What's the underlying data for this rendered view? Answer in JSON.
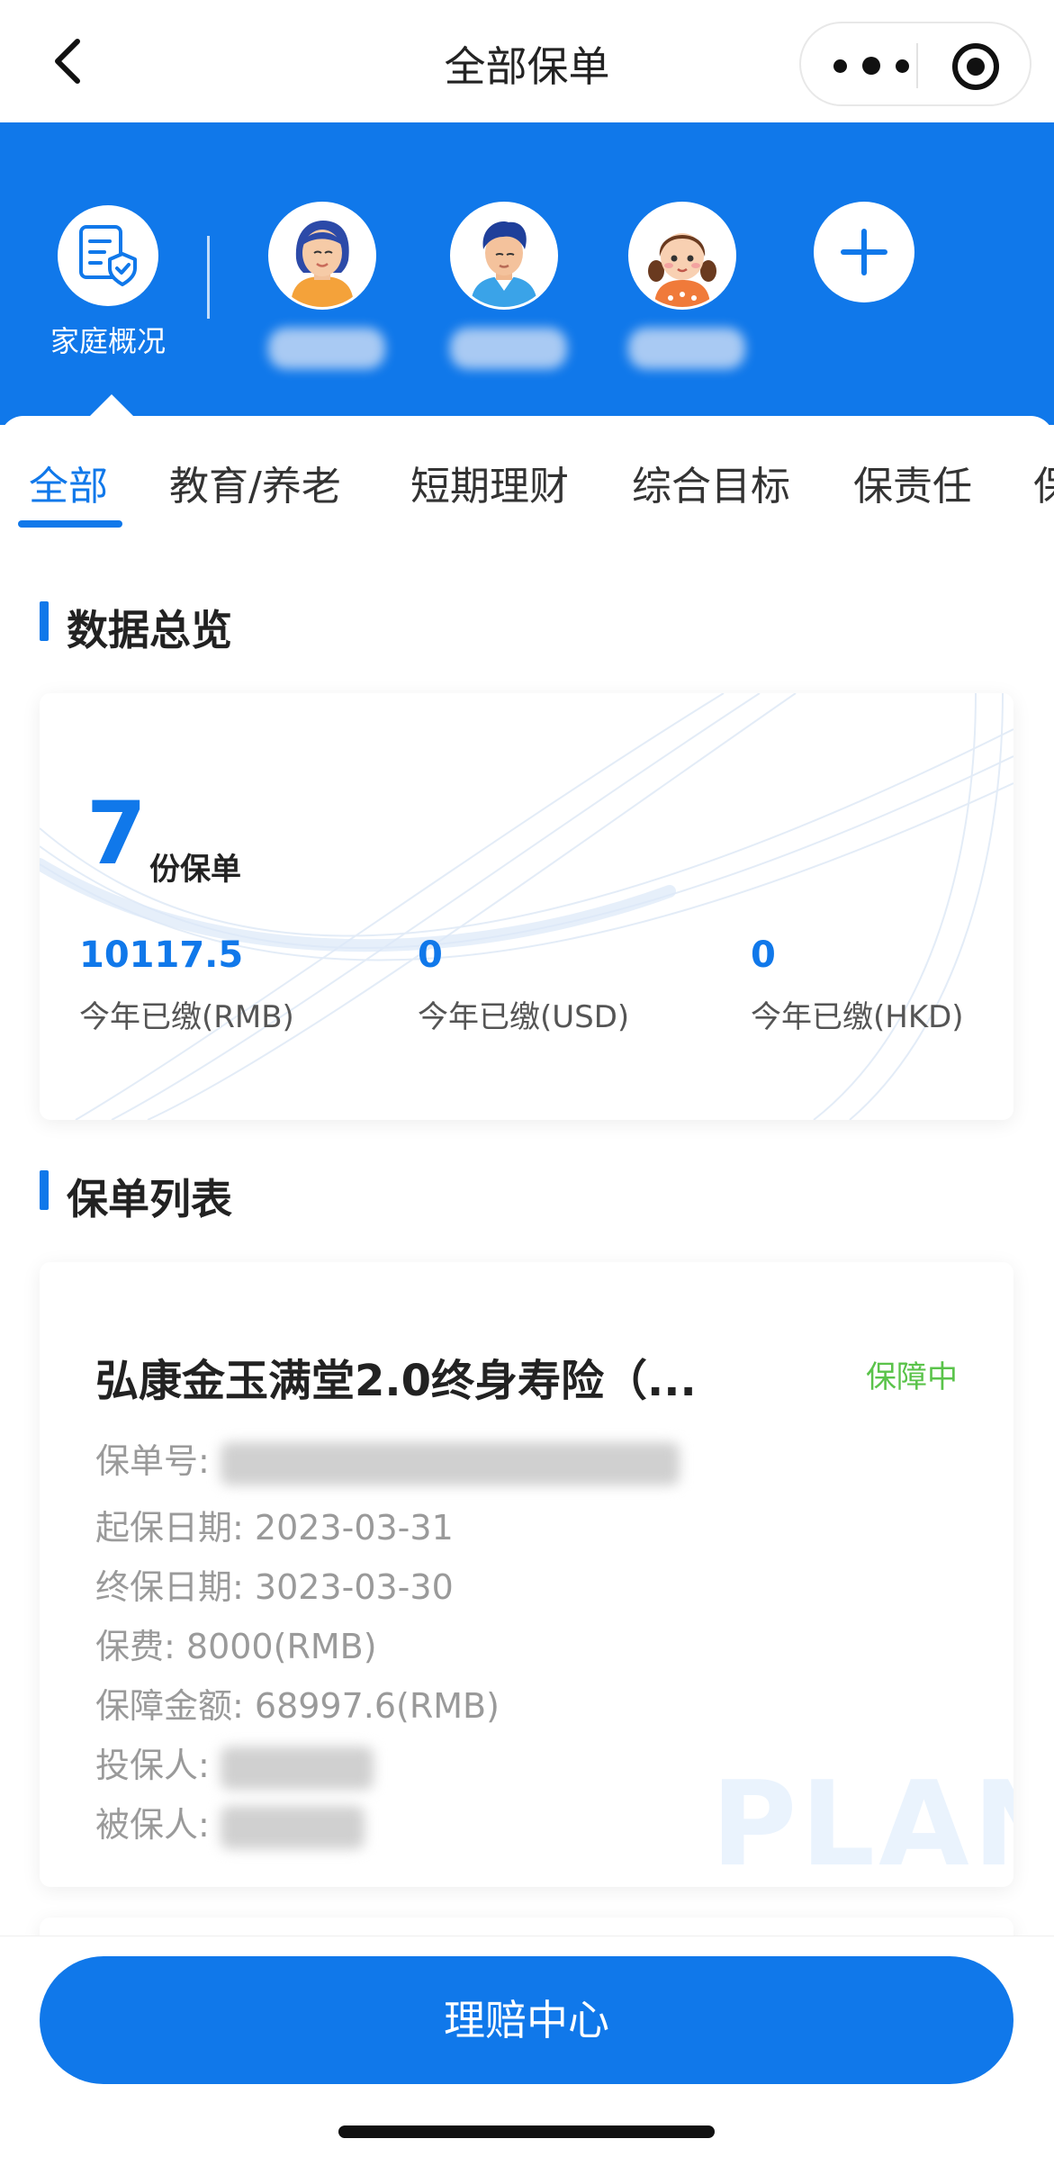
{
  "nav": {
    "title": "全部保单",
    "back_icon": "chevron-left-icon",
    "more_icon": "more-dots-icon",
    "target_icon": "target-icon"
  },
  "header": {
    "family_label": "家庭概况",
    "family_icon": "document-shield-icon",
    "members": [
      {
        "avatar": "woman-avatar-icon",
        "name": ""
      },
      {
        "avatar": "man-avatar-icon",
        "name": ""
      },
      {
        "avatar": "girl-avatar-icon",
        "name": ""
      }
    ],
    "add_icon": "plus-icon",
    "bg_color": "#1078ea"
  },
  "tabs": [
    {
      "label": "全部",
      "active": true
    },
    {
      "label": "教育/养老",
      "active": false
    },
    {
      "label": "短期理财",
      "active": false
    },
    {
      "label": "综合目标",
      "active": false
    },
    {
      "label": "保责任",
      "active": false
    },
    {
      "label": "保",
      "active": false
    }
  ],
  "overview": {
    "section_title": "数据总览",
    "count": "7",
    "count_unit": "份保单",
    "stats": [
      {
        "value": "10117.5",
        "label": "今年已缴(RMB)"
      },
      {
        "value": "0",
        "label": "今年已缴(USD)"
      },
      {
        "value": "0",
        "label": "今年已缴(HKD)"
      }
    ]
  },
  "policy_list": {
    "section_title": "保单列表",
    "items": [
      {
        "name": "弘康金玉满堂2.0终身寿险（...",
        "status": "保障中",
        "policy_no_label": "保单号:",
        "start_label": "起保日期:",
        "start_value": "2023-03-31",
        "end_label": "终保日期:",
        "end_value": "3023-03-30",
        "premium_label": "保费:",
        "premium_value": "8000(RMB)",
        "coverage_label": "保障金额:",
        "coverage_value": "68997.6(RMB)",
        "holder_label": "投保人:",
        "insured_label": "被保人:",
        "watermark": "PLAN"
      }
    ]
  },
  "bottom": {
    "claim_button": "理赔中心"
  },
  "colors": {
    "accent": "#1078ea",
    "status_active": "#5ac34a"
  }
}
